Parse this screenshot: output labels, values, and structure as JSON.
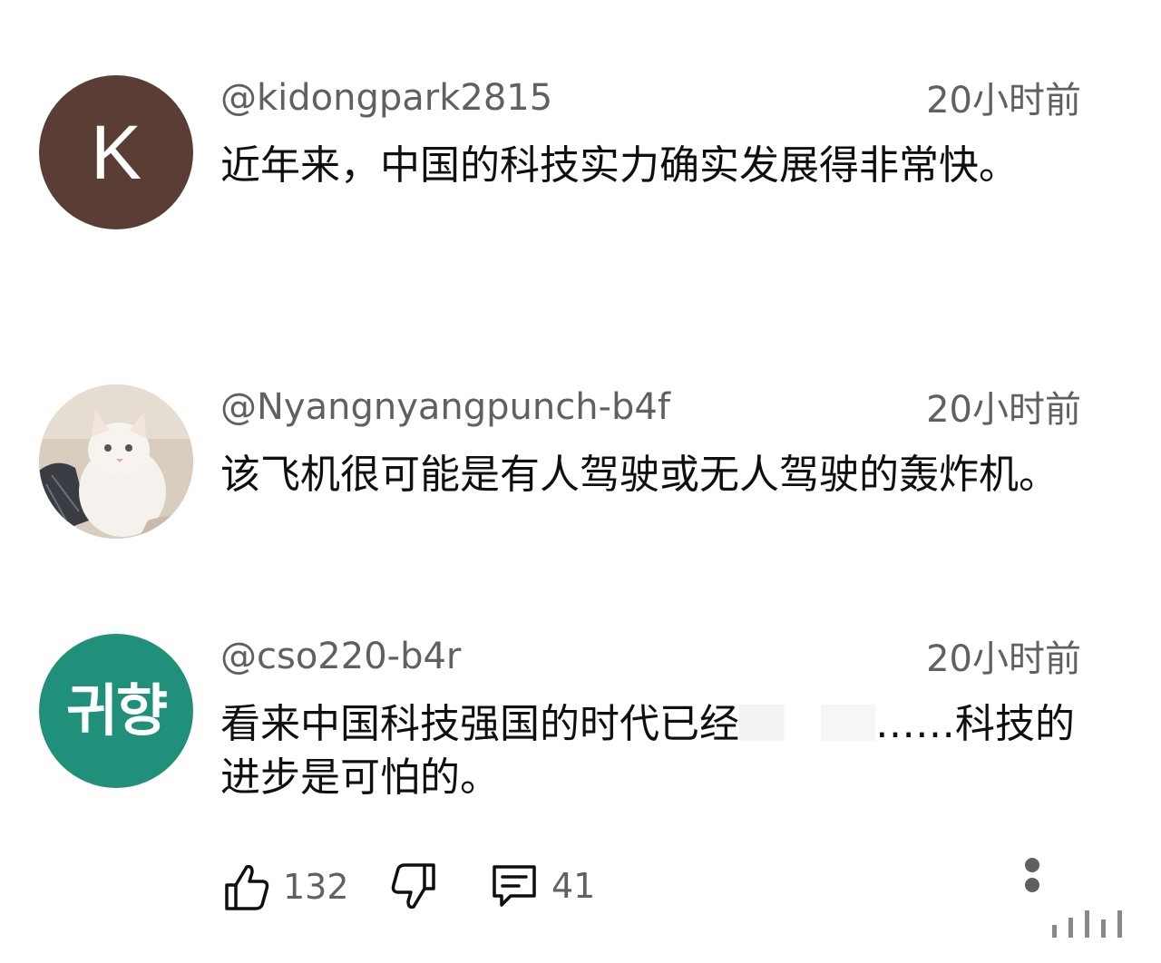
{
  "comments": [
    {
      "avatar_text": "K",
      "avatar_color": "#5a3e35",
      "username": "@kidongpark2815",
      "timestamp": "20小时前",
      "text": "近年来，中国的科技实力确实发展得非常快。"
    },
    {
      "avatar_text": "",
      "avatar_color": "#d9cfc4",
      "username": "@Nyangnyangpunch-b4f",
      "timestamp": "20小时前",
      "text": "该飞机很可能是有人驾驶或无人驾驶的轰炸机。"
    },
    {
      "avatar_text": "귀향",
      "avatar_color": "#21907a",
      "username": "@cso220-b4r",
      "timestamp": "20小时前",
      "text_part1": "看来中国科技强国的时代已经",
      "text_part2": "……科技的进步是可怕的。"
    }
  ],
  "actions": {
    "like_icon": "thumbs-up-icon",
    "like_count": "132",
    "dislike_icon": "thumbs-down-icon",
    "reply_icon": "comment-icon",
    "reply_count": "41",
    "more_icon": "more-vertical-icon"
  },
  "colors": {
    "secondary_text": "#606060",
    "primary_text": "#0f0f0f"
  }
}
